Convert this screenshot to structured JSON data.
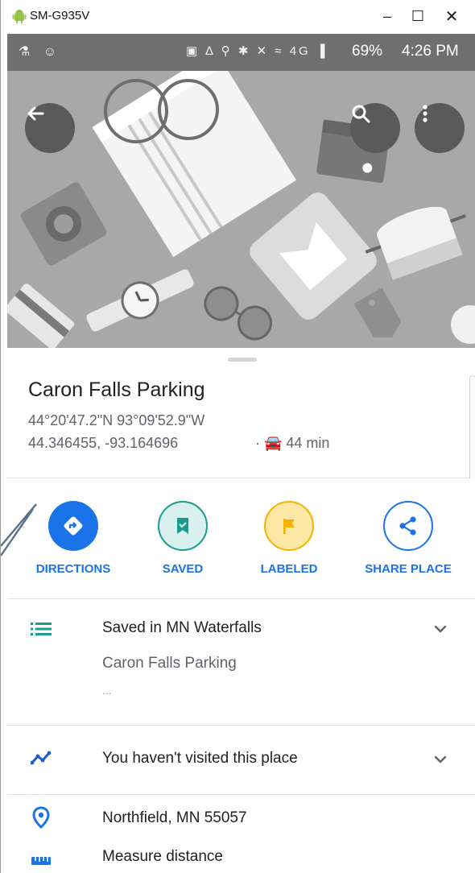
{
  "window": {
    "title": "SM-G935V",
    "min_label": "–",
    "max_label": "☐",
    "close_label": "✕"
  },
  "status_bar": {
    "left_icons": "⚗ ☺",
    "right_icons": "▣ ∆ ⚲ ✱ ✕ ≈ 4G ▐",
    "battery": "69%",
    "time": "4:26 PM"
  },
  "place": {
    "name": "Caron Falls Parking",
    "coords_dms": "44°20'47.2\"N 93°09'52.9\"W",
    "coords_decimal": "44.346455, -93.164696",
    "drive_time": "· 🚘 44 min"
  },
  "actions": [
    {
      "label": "DIRECTIONS",
      "icon": "directions-icon",
      "color": "#1a73e8"
    },
    {
      "label": "SAVED",
      "icon": "bookmark-icon",
      "color": "#1a9c8c"
    },
    {
      "label": "LABELED",
      "icon": "flag-icon",
      "color": "#f2b400"
    },
    {
      "label": "SHARE PLACE",
      "icon": "share-icon",
      "color": "#1a73e8"
    }
  ],
  "rows": {
    "saved": {
      "title": "Saved in MN Waterfalls",
      "subtitle": "Caron Falls Parking",
      "dots": "..."
    },
    "visited": {
      "title": "You haven't visited this place"
    },
    "address": {
      "title": "Northfield, MN 55057"
    },
    "measure": {
      "title": "Measure distance"
    }
  },
  "colors": {
    "accent": "#1a73e8",
    "hero_bg": "#a9a9a9",
    "status_bg": "#6f6f6f"
  }
}
